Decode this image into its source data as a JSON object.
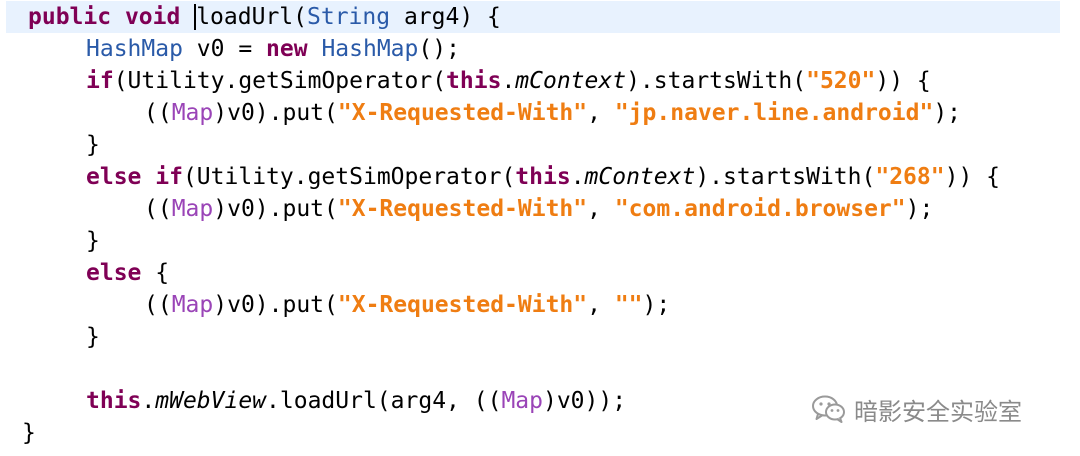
{
  "lines": [
    {
      "public": "public",
      "void": "void",
      "method": "loadUrl",
      "p1": "(",
      "type": "String",
      "p2": " arg4) {"
    },
    {
      "type": "HashMap",
      "p1": " v0 = ",
      "new": "new",
      "type2": "HashMap",
      "p2": "();"
    },
    {
      "if": "if",
      "p1": "(Utility.getSimOperator(",
      "this": "this",
      "p2": ".",
      "field": "mContext",
      "p3": ").startsWith(",
      "str": "\"520\"",
      "p4": ")) {"
    },
    {
      "p1": "((",
      "type": "Map",
      "p2": ")v0).put(",
      "s1": "\"X-Requested-With\"",
      "p3": ", ",
      "s2": "\"jp.naver.line.android\"",
      "p4": ");"
    },
    {
      "p1": "}"
    },
    {
      "else": "else",
      "if": "if",
      "p1": "(Utility.getSimOperator(",
      "this": "this",
      "p2": ".",
      "field": "mContext",
      "p3": ").startsWith(",
      "str": "\"268\"",
      "p4": ")) {"
    },
    {
      "p1": "((",
      "type": "Map",
      "p2": ")v0).put(",
      "s1": "\"X-Requested-With\"",
      "p3": ", ",
      "s2": "\"com.android.browser\"",
      "p4": ");"
    },
    {
      "p1": "}"
    },
    {
      "else": "else",
      "p1": " {"
    },
    {
      "p1": "((",
      "type": "Map",
      "p2": ")v0).put(",
      "s1": "\"X-Requested-With\"",
      "p3": ", ",
      "s2": "\"\"",
      "p4": ");"
    },
    {
      "p1": "}"
    },
    {
      "this": "this",
      "p1": ".",
      "field": "mWebView",
      "p2": ".loadUrl(arg4, ((",
      "type": "Map",
      "p3": ")v0));"
    },
    {
      "p1": "}"
    }
  ],
  "watermark": {
    "text": "暗影安全实验室",
    "icon": "wechat-icon"
  }
}
